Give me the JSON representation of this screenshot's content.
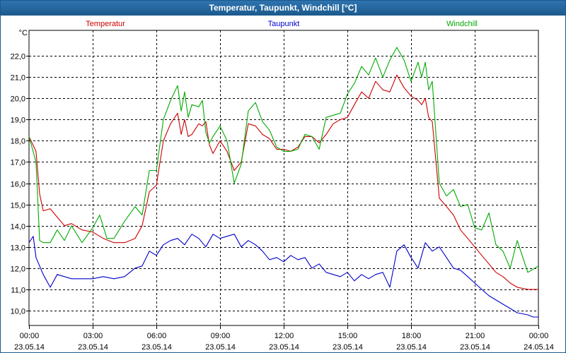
{
  "window": {
    "title": "Temperatur, Taupunkt, Windchill [°C]"
  },
  "chart_data": {
    "type": "line",
    "title": "Temperatur, Taupunkt, Windchill [°C]",
    "ylabel": "°C",
    "ylim": [
      9.3,
      23.2
    ],
    "yticks": [
      10.0,
      11.0,
      12.0,
      13.0,
      14.0,
      15.0,
      16.0,
      17.0,
      18.0,
      19.0,
      20.0,
      21.0,
      22.0
    ],
    "ytick_labels": [
      "10,0",
      "11,0",
      "12,0",
      "13,0",
      "14,0",
      "15,0",
      "16,0",
      "17,0",
      "18,0",
      "19,0",
      "20,0",
      "21,0",
      "22,0"
    ],
    "xlim": [
      "23.05.14 00:00",
      "24.05.14 00:00"
    ],
    "xticks": [
      0,
      3,
      6,
      9,
      12,
      15,
      18,
      21,
      24
    ],
    "xtick_labels": [
      [
        "00:00",
        "23.05.14"
      ],
      [
        "03:00",
        "23.05.14"
      ],
      [
        "06:00",
        "23.05.14"
      ],
      [
        "09:00",
        "23.05.14"
      ],
      [
        "12:00",
        "23.05.14"
      ],
      [
        "15:00",
        "23.05.14"
      ],
      [
        "18:00",
        "23.05.14"
      ],
      [
        "21:00",
        "23.05.14"
      ],
      [
        "00:00",
        "24.05.14"
      ]
    ],
    "grid": true,
    "legend": [
      "Temperatur",
      "Taupunkt",
      "Windchill"
    ],
    "series": [
      {
        "name": "Temperatur",
        "color": "#cc0000",
        "x": [
          0.0,
          0.33,
          0.5,
          0.67,
          1.0,
          1.33,
          1.67,
          2.0,
          2.5,
          3.0,
          3.5,
          4.0,
          4.5,
          5.0,
          5.33,
          5.67,
          6.0,
          6.33,
          6.67,
          7.0,
          7.17,
          7.33,
          7.5,
          7.67,
          8.0,
          8.17,
          8.33,
          8.5,
          8.67,
          9.0,
          9.33,
          9.67,
          10.0,
          10.33,
          10.67,
          11.0,
          11.33,
          11.67,
          12.0,
          12.33,
          12.67,
          13.0,
          13.33,
          13.67,
          14.0,
          14.33,
          14.67,
          15.0,
          15.33,
          15.67,
          16.0,
          16.33,
          16.67,
          17.0,
          17.33,
          17.67,
          18.0,
          18.33,
          18.5,
          18.67,
          18.83,
          19.0,
          19.33,
          19.67,
          20.0,
          20.33,
          20.67,
          21.0,
          21.33,
          21.67,
          22.0,
          22.33,
          22.67,
          23.0,
          23.5,
          24.0
        ],
        "y": [
          18.2,
          17.5,
          15.5,
          14.7,
          14.8,
          14.4,
          14.0,
          14.1,
          13.8,
          13.7,
          13.4,
          13.2,
          13.2,
          13.4,
          14.0,
          15.6,
          15.9,
          18.0,
          18.8,
          19.3,
          18.3,
          19.0,
          18.2,
          18.3,
          18.8,
          18.7,
          18.9,
          17.8,
          17.4,
          18.0,
          17.5,
          16.6,
          17.0,
          18.8,
          18.7,
          18.3,
          18.1,
          17.6,
          17.6,
          17.5,
          17.7,
          18.2,
          18.2,
          17.9,
          18.3,
          18.8,
          19.0,
          19.1,
          19.7,
          20.3,
          20.0,
          20.8,
          20.4,
          20.3,
          21.1,
          20.5,
          20.1,
          19.9,
          19.7,
          20.0,
          19.1,
          18.9,
          15.3,
          14.9,
          14.5,
          13.8,
          13.4,
          13.0,
          12.6,
          12.2,
          11.8,
          11.6,
          11.3,
          11.1,
          11.0,
          11.0
        ]
      },
      {
        "name": "Taupunkt",
        "color": "#0000cc",
        "x": [
          0.0,
          0.2,
          0.33,
          0.67,
          1.0,
          1.33,
          1.67,
          2.0,
          2.5,
          3.0,
          3.5,
          4.0,
          4.5,
          5.0,
          5.33,
          5.67,
          6.0,
          6.33,
          6.67,
          7.0,
          7.33,
          7.67,
          8.0,
          8.33,
          8.67,
          9.0,
          9.33,
          9.67,
          10.0,
          10.33,
          10.67,
          11.0,
          11.33,
          11.67,
          12.0,
          12.33,
          12.67,
          13.0,
          13.33,
          13.67,
          14.0,
          14.33,
          14.67,
          15.0,
          15.33,
          15.67,
          16.0,
          16.33,
          16.67,
          17.0,
          17.33,
          17.67,
          18.0,
          18.33,
          18.67,
          19.0,
          19.33,
          19.67,
          20.0,
          20.33,
          20.67,
          21.0,
          21.33,
          21.67,
          22.0,
          22.33,
          22.67,
          23.0,
          23.5,
          23.75,
          24.0
        ],
        "y": [
          13.2,
          13.5,
          12.5,
          11.7,
          11.1,
          11.7,
          11.6,
          11.5,
          11.5,
          11.5,
          11.6,
          11.5,
          11.6,
          12.0,
          12.1,
          12.8,
          12.6,
          13.1,
          13.3,
          13.4,
          13.1,
          13.6,
          13.4,
          13.0,
          13.6,
          13.4,
          13.5,
          13.6,
          13.0,
          13.3,
          13.1,
          12.8,
          12.4,
          12.5,
          12.3,
          12.6,
          12.4,
          12.5,
          12.0,
          12.2,
          11.8,
          11.7,
          11.6,
          11.8,
          11.4,
          11.7,
          11.5,
          11.7,
          11.8,
          11.1,
          12.8,
          13.1,
          12.5,
          12.0,
          13.2,
          12.8,
          13.0,
          12.5,
          12.0,
          11.9,
          11.6,
          11.3,
          11.0,
          10.7,
          10.5,
          10.3,
          10.1,
          9.9,
          9.8,
          9.7,
          9.7
        ]
      },
      {
        "name": "Windchill",
        "color": "#00aa00",
        "x": [
          0.0,
          0.33,
          0.5,
          0.67,
          1.0,
          1.33,
          1.67,
          2.0,
          2.5,
          3.0,
          3.33,
          3.67,
          4.0,
          4.5,
          5.0,
          5.33,
          5.67,
          6.0,
          6.33,
          6.67,
          7.0,
          7.17,
          7.33,
          7.5,
          7.67,
          8.0,
          8.17,
          8.33,
          8.5,
          8.67,
          9.0,
          9.33,
          9.67,
          10.0,
          10.33,
          10.67,
          11.0,
          11.33,
          11.67,
          12.0,
          12.33,
          12.67,
          13.0,
          13.33,
          13.67,
          14.0,
          14.33,
          14.67,
          15.0,
          15.33,
          15.67,
          16.0,
          16.33,
          16.67,
          17.0,
          17.33,
          17.67,
          18.0,
          18.33,
          18.5,
          18.67,
          18.83,
          19.0,
          19.33,
          19.67,
          20.0,
          20.33,
          20.67,
          21.0,
          21.33,
          21.67,
          22.0,
          22.33,
          22.67,
          23.0,
          23.5,
          24.0
        ],
        "y": [
          18.2,
          17.0,
          13.3,
          13.2,
          13.2,
          13.8,
          13.3,
          14.0,
          13.2,
          13.9,
          14.5,
          13.4,
          13.4,
          14.2,
          14.9,
          14.5,
          16.6,
          16.6,
          19.0,
          19.9,
          20.6,
          19.4,
          20.3,
          19.1,
          19.7,
          19.6,
          19.9,
          18.4,
          17.9,
          18.2,
          18.7,
          18.0,
          16.0,
          16.9,
          19.4,
          19.8,
          18.9,
          18.5,
          17.7,
          17.5,
          17.5,
          17.6,
          18.3,
          18.2,
          17.6,
          19.1,
          19.2,
          19.3,
          20.2,
          20.7,
          21.5,
          21.1,
          21.9,
          21.0,
          21.8,
          22.4,
          21.8,
          20.8,
          21.7,
          21.0,
          21.7,
          20.4,
          20.8,
          16.0,
          15.4,
          15.7,
          14.9,
          15.0,
          13.9,
          13.8,
          14.6,
          13.1,
          12.8,
          12.0,
          13.3,
          11.8,
          12.1
        ]
      }
    ]
  }
}
